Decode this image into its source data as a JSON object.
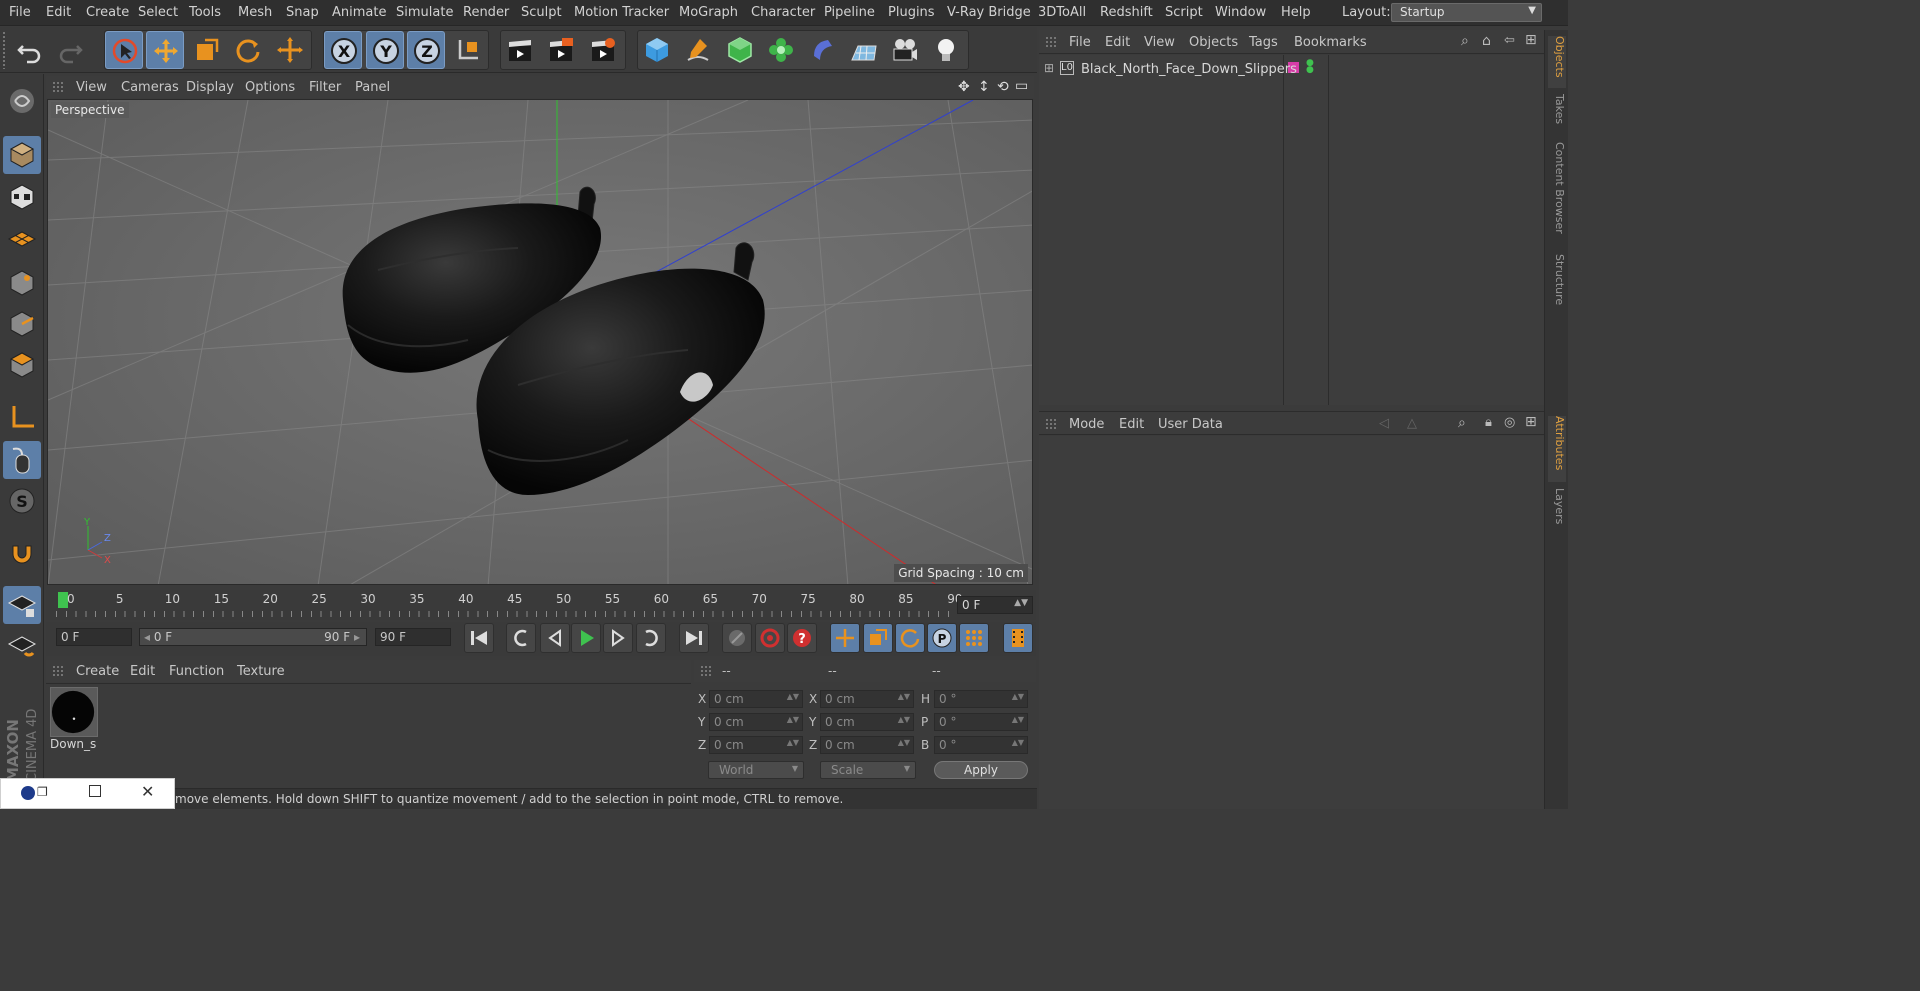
{
  "menubar": {
    "items": [
      "File",
      "Edit",
      "Create",
      "Select",
      "Tools",
      "Mesh",
      "Snap",
      "Animate",
      "Simulate",
      "Render",
      "Sculpt",
      "Motion Tracker",
      "MoGraph",
      "Character",
      "Pipeline",
      "Plugins",
      "V-Ray Bridge",
      "3DToAll",
      "Redshift",
      "Script",
      "Window",
      "Help"
    ],
    "layout_label": "Layout:",
    "layout_value": "Startup"
  },
  "viewport": {
    "menu": [
      "View",
      "Cameras",
      "Display",
      "Options",
      "Filter",
      "Panel"
    ],
    "camera_label": "Perspective",
    "grid_spacing": "Grid Spacing : 10 cm",
    "axis_labels": {
      "y": "Y",
      "z": "Z",
      "x": "X"
    }
  },
  "timeline": {
    "ticks": [
      "0",
      "5",
      "10",
      "15",
      "20",
      "25",
      "30",
      "35",
      "40",
      "45",
      "50",
      "55",
      "60",
      "65",
      "70",
      "75",
      "80",
      "85",
      "90"
    ],
    "current_frame": "0 F",
    "start_field": "0 F",
    "range_start": "0 F",
    "range_end": "90 F",
    "end_field": "90 F"
  },
  "material_manager": {
    "menu": [
      "Create",
      "Edit",
      "Function",
      "Texture"
    ],
    "material_name": "Down_s"
  },
  "coordinates": {
    "headers": [
      "--",
      "--",
      "--"
    ],
    "rows": [
      {
        "a_lbl": "X",
        "a_val": "0 cm",
        "b_lbl": "X",
        "b_val": "0 cm",
        "c_lbl": "H",
        "c_val": "0 °"
      },
      {
        "a_lbl": "Y",
        "a_val": "0 cm",
        "b_lbl": "Y",
        "b_val": "0 cm",
        "c_lbl": "P",
        "c_val": "0 °"
      },
      {
        "a_lbl": "Z",
        "a_val": "0 cm",
        "b_lbl": "Z",
        "b_val": "0 cm",
        "c_lbl": "B",
        "c_val": "0 °"
      }
    ],
    "space_dropdown": "World",
    "mode_dropdown": "Scale",
    "apply_label": "Apply"
  },
  "status_bar": {
    "text": "move elements. Hold down SHIFT to quantize movement / add to the selection in point mode, CTRL to remove."
  },
  "object_manager": {
    "menu": [
      "File",
      "Edit",
      "View",
      "Objects",
      "Tags",
      "Bookmarks"
    ],
    "object_name": "Black_North_Face_Down_Slippers",
    "object_layer_icon": "L0",
    "tag_color": "#d63ca8"
  },
  "attributes": {
    "menu": [
      "Mode",
      "Edit",
      "User Data"
    ]
  },
  "right_tabs": [
    "Objects",
    "Takes",
    "Content Browser",
    "Structure",
    "Attributes",
    "Layers"
  ],
  "brand": {
    "maxon": "MAXON",
    "product": "CINEMA 4D"
  },
  "colors": {
    "accent": "#5d7fa8",
    "tool_orange": "#e89a2a",
    "play_green": "#3fc24f",
    "stop_red": "#d03030"
  }
}
